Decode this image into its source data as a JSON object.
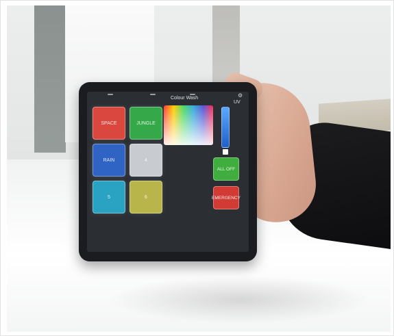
{
  "app": {
    "panel_title": "Colour Wash",
    "uv_label": "UV"
  },
  "scenes": [
    {
      "label": "SPACE",
      "color": "#d9473f"
    },
    {
      "label": "JUNGLE",
      "color": "#35a84a"
    },
    {
      "label": "RAIN",
      "color": "#2f63c4"
    },
    {
      "label": "4",
      "color": "#c8ccd0"
    },
    {
      "label": "5",
      "color": "#2aa2c2"
    },
    {
      "label": "6",
      "color": "#b8b64a"
    }
  ],
  "actions": {
    "all_off": {
      "label": "ALL OFF",
      "color": "#3fae3f"
    },
    "emergency": {
      "label": "EMERGENCY",
      "color": "#d23a34"
    }
  },
  "icons": {
    "settings": "gear-icon"
  }
}
